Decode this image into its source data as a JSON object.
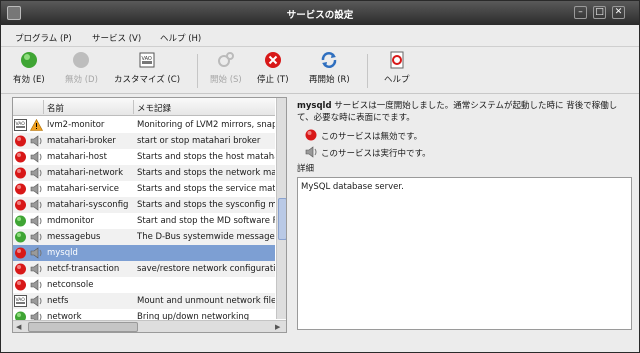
{
  "window": {
    "title": "サービスの設定"
  },
  "menubar": {
    "items": [
      "プログラム (P)",
      "サービス (V)",
      "ヘルプ (H)"
    ]
  },
  "toolbar": {
    "enable": "有効 (E)",
    "disable": "無効 (D)",
    "customize": "カスタマイズ (C)",
    "start": "開始 (S)",
    "stop": "停止 (T)",
    "restart": "再開始 (R)",
    "help": "ヘルプ"
  },
  "list": {
    "col_name": "名前",
    "col_desc": "メモ記録",
    "rows": [
      {
        "status": "custom",
        "run": "warning",
        "name": "lvm2-monitor",
        "desc": "Monitoring of LVM2 mirrors, snapshots etc."
      },
      {
        "status": "disabled",
        "run": "stopped",
        "name": "matahari-broker",
        "desc": "start or stop matahari broker"
      },
      {
        "status": "disabled",
        "run": "stopped",
        "name": "matahari-host",
        "desc": "Starts and stops the host matahari agent"
      },
      {
        "status": "disabled",
        "run": "stopped",
        "name": "matahari-network",
        "desc": "Starts and stops the network matahari agent"
      },
      {
        "status": "disabled",
        "run": "stopped",
        "name": "matahari-service",
        "desc": "Starts and stops the service matahari agent"
      },
      {
        "status": "disabled",
        "run": "stopped",
        "name": "matahari-sysconfig",
        "desc": "Starts and stops the sysconfig matahari agent"
      },
      {
        "status": "enabled",
        "run": "stopped",
        "name": "mdmonitor",
        "desc": "Start and stop the MD software RAID monitor"
      },
      {
        "status": "enabled",
        "run": "stopped",
        "name": "messagebus",
        "desc": "The D-Bus systemwide message bus"
      },
      {
        "status": "disabled",
        "run": "stopped",
        "name": "mysqld",
        "desc": ""
      },
      {
        "status": "disabled",
        "run": "stopped",
        "name": "netcf-transaction",
        "desc": "save/restore network configuration files"
      },
      {
        "status": "disabled",
        "run": "stopped",
        "name": "netconsole",
        "desc": ""
      },
      {
        "status": "custom",
        "run": "stopped",
        "name": "netfs",
        "desc": "Mount and unmount network filesystems"
      },
      {
        "status": "enabled",
        "run": "stopped",
        "name": "network",
        "desc": "Bring up/down networking"
      }
    ],
    "selected": "mysqld"
  },
  "detail": {
    "service": "mysqld",
    "summary": " サービスは一度開始しました。通常システムが起動した時に 背後で稼働して、必要な時に表面にでます。",
    "status_disabled": "このサービスは無効です。",
    "status_running": "このサービスは実行中です。",
    "details_label": "詳細",
    "details_text": "MySQL database server."
  },
  "colors": {
    "enabled": "#3fa534",
    "disabled": "#d81818",
    "selection": "#7d9fd3"
  }
}
